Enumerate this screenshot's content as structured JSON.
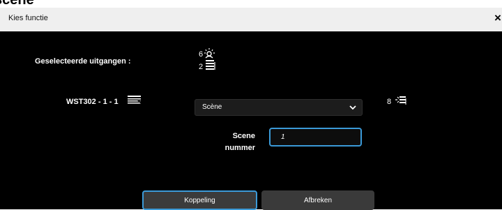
{
  "page": {
    "background_title": "scène"
  },
  "dialog": {
    "title": "Kies functie",
    "close_symbol": "×",
    "selected_outputs": {
      "label": "Geselecteerde uitgangen :",
      "items": [
        {
          "count": "6",
          "icon": "light-group-icon"
        },
        {
          "count": "2",
          "icon": "shutter-icon"
        }
      ]
    },
    "output_row": {
      "label": "WST302 - 1 - 1",
      "icon": "screen-blind-icon",
      "select": {
        "value": "Scène"
      },
      "count": "8",
      "count_icon": "light-shutter-icon"
    },
    "scene": {
      "label_line1": "Scene",
      "label_line2": "nummer",
      "value": "1"
    },
    "buttons": {
      "primary": "Koppeling",
      "secondary": "Afbreken"
    },
    "colors": {
      "accent": "#3b9ad8",
      "background": "#000000",
      "header": "#efefef",
      "button": "#3a3a3a"
    }
  }
}
